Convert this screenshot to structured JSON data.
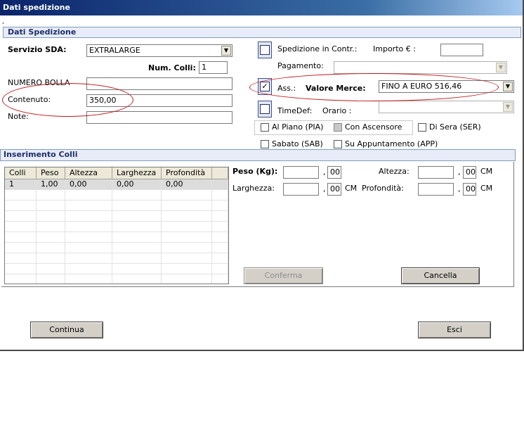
{
  "window": {
    "title": "Dati spedizione"
  },
  "colors": {
    "titlebar": "#0a246a",
    "ellipse": "#c0161c",
    "section_header_text": "#1c2f6a"
  },
  "dati_spedizione": {
    "header": "Dati Spedizione",
    "servizio_label": "Servizio SDA:",
    "servizio_value": "EXTRALARGE",
    "num_colli_label": "Num. Colli:",
    "num_colli_value": "1",
    "numero_bolla_label": "NUMERO BOLLA",
    "numero_bolla_value": "",
    "contenuto_label": "Contenuto:",
    "contenuto_value": "350,00",
    "note_label": "Note:",
    "note_value": "",
    "spedizione_contr_label": "Spedizione in Contr.:",
    "spedizione_contr_checked": false,
    "importo_label": "Importo € :",
    "importo_value": "",
    "pagamento_label": "Pagamento:",
    "pagamento_value": "",
    "ass_label": "Ass.:",
    "ass_checked": true,
    "valore_merce_label": "Valore Merce:",
    "valore_merce_value": "FINO A EURO 516,46",
    "timedef_label": "TimeDef:",
    "timedef_checked": false,
    "orario_label": "Orario :",
    "orario_value": "",
    "options": {
      "al_piano": "Al Piano (PIA)",
      "con_ascensore": "Con Ascensore",
      "di_sera": "Di Sera (SER)",
      "sabato": "Sabato (SAB)",
      "su_appuntamento": "Su Appuntamento (APP)"
    }
  },
  "inserimento_colli": {
    "header": "Inserimento Colli",
    "columns": [
      "Colli",
      "Peso",
      "Altezza",
      "Larghezza",
      "Profondità",
      ""
    ],
    "rows": [
      [
        "1",
        "1,00",
        "0,00",
        "0,00",
        "0,00",
        ""
      ]
    ],
    "peso_label": "Peso (Kg):",
    "peso_int": "",
    "peso_dec": "00",
    "altezza_label": "Altezza:",
    "altezza_int": "",
    "altezza_dec": "00",
    "altezza_unit": "CM",
    "larghezza_label": "Larghezza:",
    "larghezza_int": "",
    "larghezza_dec": "00",
    "larghezza_unit": "CM",
    "profondita_label": "Profondità:",
    "profondita_int": "",
    "profondita_dec": "00",
    "profondita_unit": "CM",
    "comma": ",",
    "conferma_label": "Conferma",
    "cancella_label": "Cancella"
  },
  "footer": {
    "continua_label": "Continua",
    "esci_label": "Esci"
  }
}
